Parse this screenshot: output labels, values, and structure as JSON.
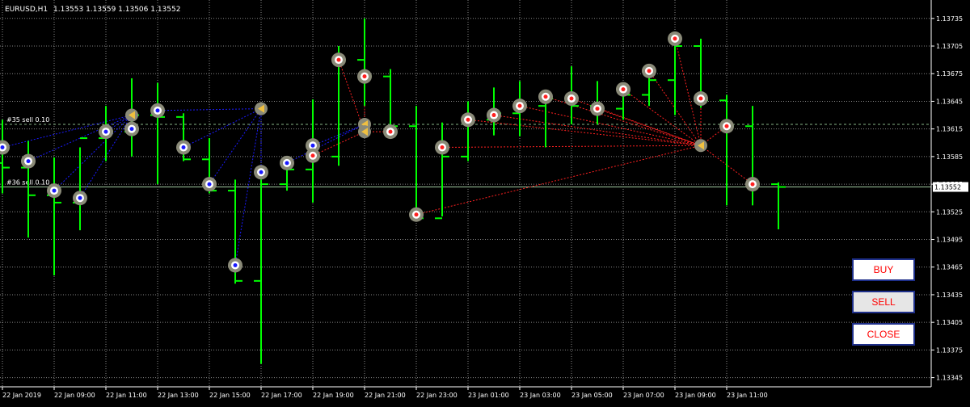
{
  "header": {
    "symbol_timeframe": "EURUSD,H1",
    "ohlc": "1.13553 1.13559 1.13506 1.13552"
  },
  "buttons": {
    "buy_label": "BUY",
    "sell_label": "SELL",
    "close_label": "CLOSE"
  },
  "colors": {
    "background": "#000000",
    "grid": "#c0c0c0",
    "bar": "#00ff00",
    "axis_text": "#ffffff",
    "buy_line": "#1a1aff",
    "sell_line": "#ff2020",
    "order_line": "#86b486",
    "current_price_bg": "#ffffff"
  },
  "chart_data": {
    "type": "ohlc",
    "title": "",
    "xlabel": "",
    "ylabel": "",
    "ylim": [
      1.13335,
      1.13755
    ],
    "yticks": [
      1.13345,
      1.13375,
      1.13405,
      1.13435,
      1.13465,
      1.13495,
      1.13525,
      1.13555,
      1.13585,
      1.13615,
      1.13645,
      1.13675,
      1.13705,
      1.13735
    ],
    "ytick_labels": [
      "1.13345",
      "1.13375",
      "1.13405",
      "1.13435",
      "1.13465",
      "1.13495",
      "1.13525",
      "1.13555",
      "1.13585",
      "1.13615",
      "1.13645",
      "1.13675",
      "1.13705",
      "1.13735"
    ],
    "xtick_labels": [
      "22 Jan 2019",
      "22 Jan 09:00",
      "22 Jan 11:00",
      "22 Jan 13:00",
      "22 Jan 15:00",
      "22 Jan 17:00",
      "22 Jan 19:00",
      "22 Jan 21:00",
      "22 Jan 23:00",
      "23 Jan 01:00",
      "23 Jan 03:00",
      "23 Jan 05:00",
      "23 Jan 07:00",
      "23 Jan 09:00",
      "23 Jan 11:00"
    ],
    "grid": true,
    "current_price": 1.13552,
    "current_price_label": "1.13552",
    "bars": [
      [
        1.13578,
        1.13625,
        1.13545,
        1.13573
      ],
      [
        1.13573,
        1.13602,
        1.13497,
        1.13543
      ],
      [
        1.13543,
        1.13584,
        1.13456,
        1.13535
      ],
      [
        1.13535,
        1.13595,
        1.13505,
        1.13605
      ],
      [
        1.13605,
        1.1364,
        1.1358,
        1.13612
      ],
      [
        1.13612,
        1.1367,
        1.13585,
        1.1363
      ],
      [
        1.1363,
        1.13665,
        1.13555,
        1.13628
      ],
      [
        1.13628,
        1.13632,
        1.1358,
        1.13582
      ],
      [
        1.13582,
        1.13605,
        1.13545,
        1.13548
      ],
      [
        1.13548,
        1.1356,
        1.13447,
        1.1345
      ],
      [
        1.1345,
        1.1356,
        1.1336,
        1.13555
      ],
      [
        1.13555,
        1.1358,
        1.13548,
        1.13571
      ],
      [
        1.13571,
        1.13647,
        1.13535,
        1.13585
      ],
      [
        1.13585,
        1.13705,
        1.13575,
        1.1369
      ],
      [
        1.1369,
        1.13735,
        1.1364,
        1.13672
      ],
      [
        1.13672,
        1.1368,
        1.13615,
        1.13618
      ],
      [
        1.13618,
        1.1364,
        1.13518,
        1.13518
      ],
      [
        1.13518,
        1.13622,
        1.1352,
        1.13585
      ],
      [
        1.13585,
        1.13645,
        1.1358,
        1.13625
      ],
      [
        1.13625,
        1.1366,
        1.13608,
        1.13632
      ],
      [
        1.13632,
        1.13667,
        1.13607,
        1.1364
      ],
      [
        1.1364,
        1.1365,
        1.13595,
        1.13648
      ],
      [
        1.13648,
        1.13683,
        1.1362,
        1.1364
      ],
      [
        1.1364,
        1.13667,
        1.1362,
        1.13637
      ],
      [
        1.13637,
        1.1366,
        1.13625,
        1.13652
      ],
      [
        1.13652,
        1.13683,
        1.1364,
        1.13668
      ],
      [
        1.13668,
        1.13707,
        1.1363,
        1.13705
      ],
      [
        1.13705,
        1.13713,
        1.13638,
        1.13646
      ],
      [
        1.13646,
        1.13652,
        1.13532,
        1.13618
      ],
      [
        1.13618,
        1.1364,
        1.13532,
        1.13555
      ],
      [
        1.13555,
        1.13557,
        1.13506,
        1.13552
      ]
    ],
    "markers_buy": [
      [
        0,
        1.13595
      ],
      [
        1,
        1.1358
      ],
      [
        2,
        1.13548
      ],
      [
        3,
        1.1354
      ],
      [
        4,
        1.13612
      ],
      [
        5,
        1.13615
      ],
      [
        6,
        1.13635
      ],
      [
        7,
        1.13595
      ],
      [
        8,
        1.13555
      ],
      [
        9,
        1.13467
      ],
      [
        10,
        1.13568
      ],
      [
        11,
        1.13578
      ],
      [
        12,
        1.13597
      ]
    ],
    "markers_sell": [
      [
        12,
        1.13586
      ],
      [
        13,
        1.1369
      ],
      [
        14,
        1.13672
      ],
      [
        15,
        1.13612
      ],
      [
        16,
        1.13522
      ],
      [
        17,
        1.13595
      ],
      [
        18,
        1.13625
      ],
      [
        19,
        1.1363
      ],
      [
        20,
        1.1364
      ],
      [
        21,
        1.1365
      ],
      [
        22,
        1.13648
      ],
      [
        23,
        1.13637
      ],
      [
        24,
        1.13658
      ],
      [
        25,
        1.13678
      ],
      [
        26,
        1.13713
      ],
      [
        27,
        1.13648
      ],
      [
        28,
        1.13618
      ],
      [
        29,
        1.13555
      ]
    ],
    "close_points_buy": [
      [
        5,
        1.1363
      ],
      [
        10,
        1.13637
      ],
      [
        14,
        1.1362
      ]
    ],
    "close_points_sell": [
      [
        27,
        1.13597
      ],
      [
        14,
        1.13612
      ]
    ],
    "orders": [
      {
        "label": "#35 sell 0.10",
        "price": 1.1362
      },
      {
        "label": "#36 sell 0.10",
        "price": 1.13552
      }
    ]
  }
}
